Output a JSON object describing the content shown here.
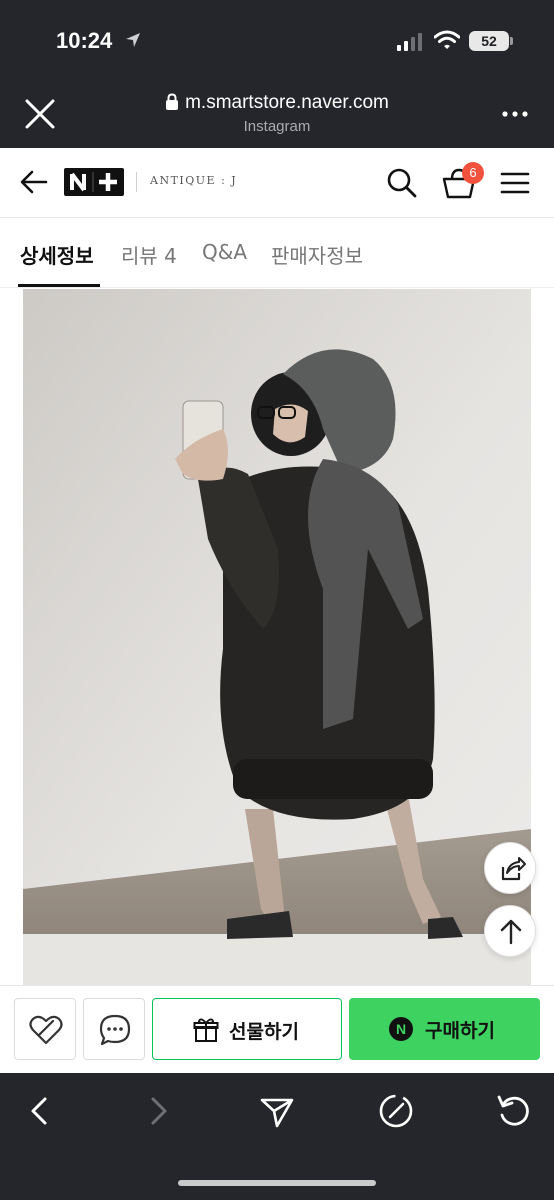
{
  "status_bar": {
    "time": "10:24",
    "battery": "52"
  },
  "browser": {
    "url": "m.smartstore.naver.com",
    "source": "Instagram"
  },
  "store": {
    "logo_text": "N+",
    "name": "ANTIQUE : J",
    "cart_count": "6"
  },
  "tabs": [
    {
      "label": "상세정보",
      "active": true
    },
    {
      "label": "리뷰 4",
      "active": false
    },
    {
      "label": "Q&A",
      "active": false
    },
    {
      "label": "판매자정보",
      "active": false
    }
  ],
  "purchase_bar": {
    "gift_label": "선물하기",
    "buy_label": "구매하기",
    "buy_badge": "N"
  },
  "colors": {
    "accent_green": "#3ed260",
    "badge_red": "#f0523d",
    "chrome_dark": "#24262b"
  }
}
